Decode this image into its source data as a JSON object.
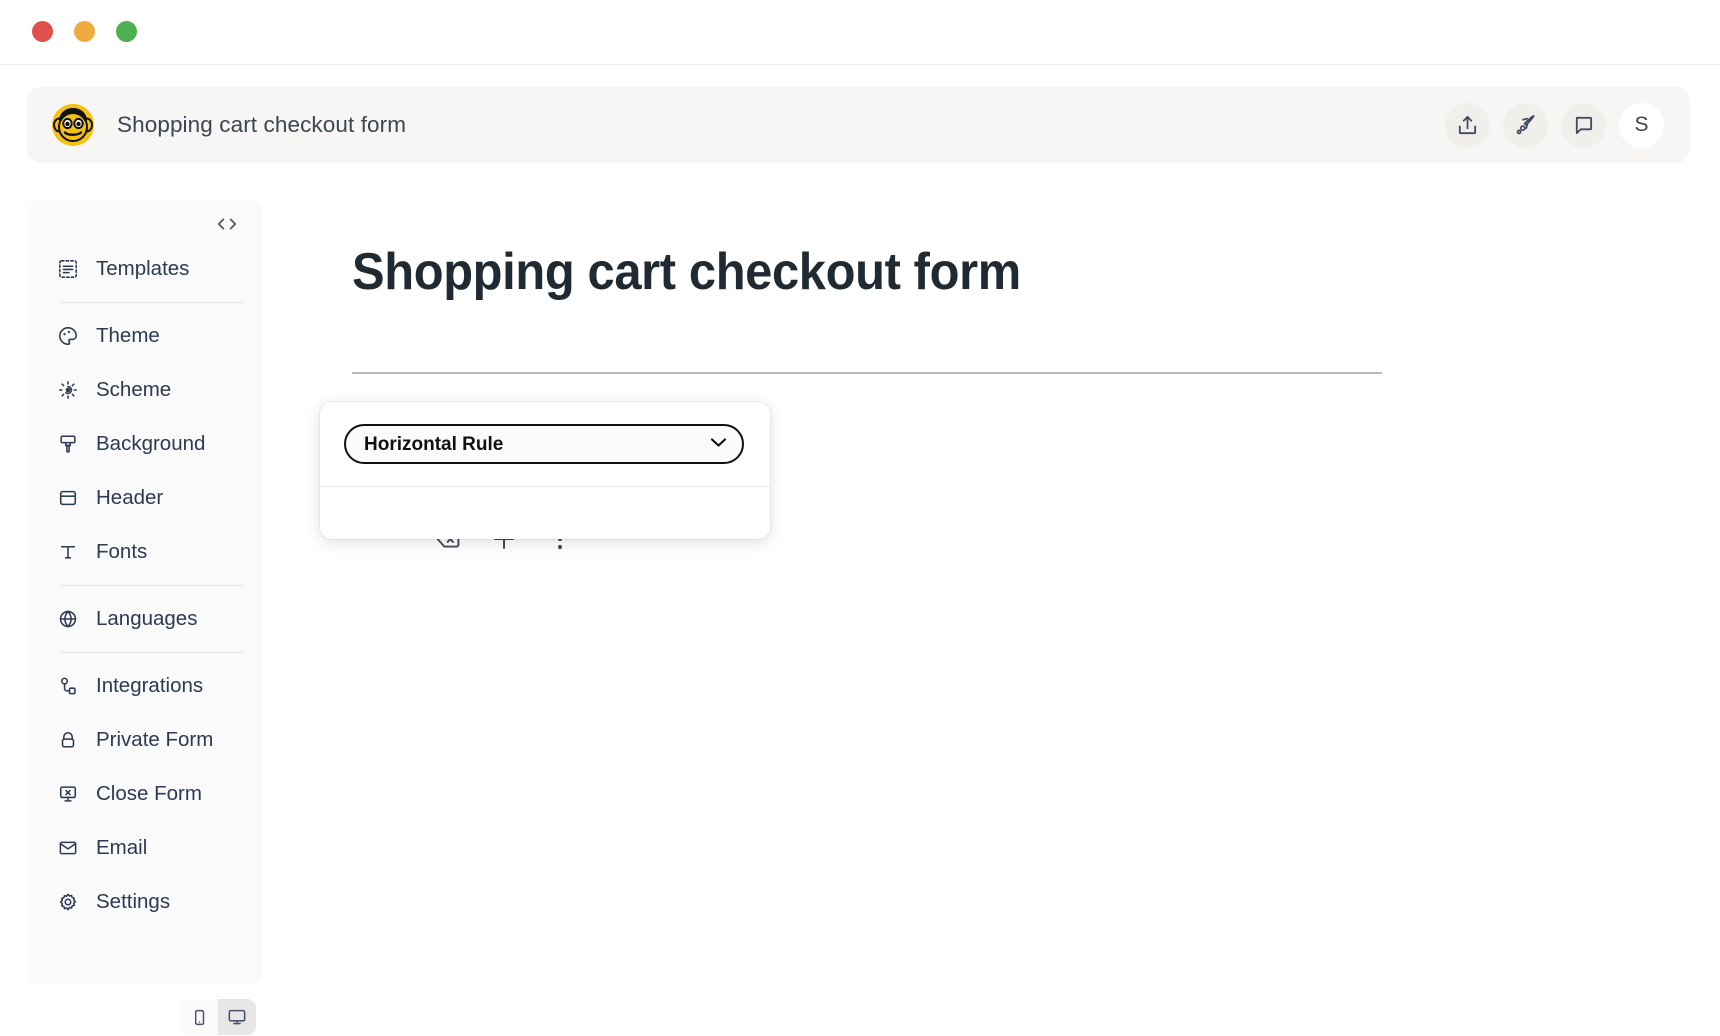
{
  "window": {
    "traffic_lights": [
      {
        "name": "close",
        "color": "#e0514b"
      },
      {
        "name": "minimize",
        "color": "#eeac3e"
      },
      {
        "name": "zoom",
        "color": "#4cb050"
      }
    ]
  },
  "appbar": {
    "logo_name": "monkey-logo",
    "title": "Shopping cart checkout form",
    "actions": [
      {
        "name": "share-icon",
        "label": "Share"
      },
      {
        "name": "rocket-icon",
        "label": "Publish"
      },
      {
        "name": "comment-icon",
        "label": "Comments"
      }
    ],
    "avatar_initial": "S"
  },
  "sidebar": {
    "code_toggle_label": "<>",
    "items": [
      {
        "label": "Templates",
        "icon": "templates-icon"
      },
      {
        "label": "Theme",
        "icon": "palette-icon"
      },
      {
        "label": "Scheme",
        "icon": "scheme-icon"
      },
      {
        "label": "Background",
        "icon": "brush-icon"
      },
      {
        "label": "Header",
        "icon": "header-icon"
      },
      {
        "label": "Fonts",
        "icon": "fonts-icon"
      },
      {
        "label": "Languages",
        "icon": "globe-icon"
      },
      {
        "label": "Integrations",
        "icon": "integrations-icon"
      },
      {
        "label": "Private Form",
        "icon": "lock-icon"
      },
      {
        "label": "Close Form",
        "icon": "close-form-icon"
      },
      {
        "label": "Email",
        "icon": "mail-icon"
      },
      {
        "label": "Settings",
        "icon": "gear-icon"
      }
    ]
  },
  "device_toggle": {
    "options": [
      {
        "name": "mobile-view",
        "label": "Mobile",
        "active": false
      },
      {
        "name": "desktop-view",
        "label": "Desktop",
        "active": true
      }
    ]
  },
  "canvas": {
    "form_title": "Shopping cart checkout form",
    "block": {
      "type": "horizontal-rule",
      "toolbar": [
        {
          "name": "delete-block-icon",
          "label": "Delete"
        },
        {
          "name": "add-block-icon",
          "label": "Add"
        },
        {
          "name": "more-options-icon",
          "label": "More"
        }
      ]
    }
  },
  "popover": {
    "selected_block_type": "Horizontal Rule",
    "block_type_options": [
      "Horizontal Rule"
    ]
  },
  "colors": {
    "appbar_bg": "#f7f6f4",
    "sidebar_bg": "#fafafa",
    "text": "#2c3a52",
    "title": "#1f2a33",
    "rule": "#b8b8b8",
    "logo_yellow": "#f5c016"
  }
}
